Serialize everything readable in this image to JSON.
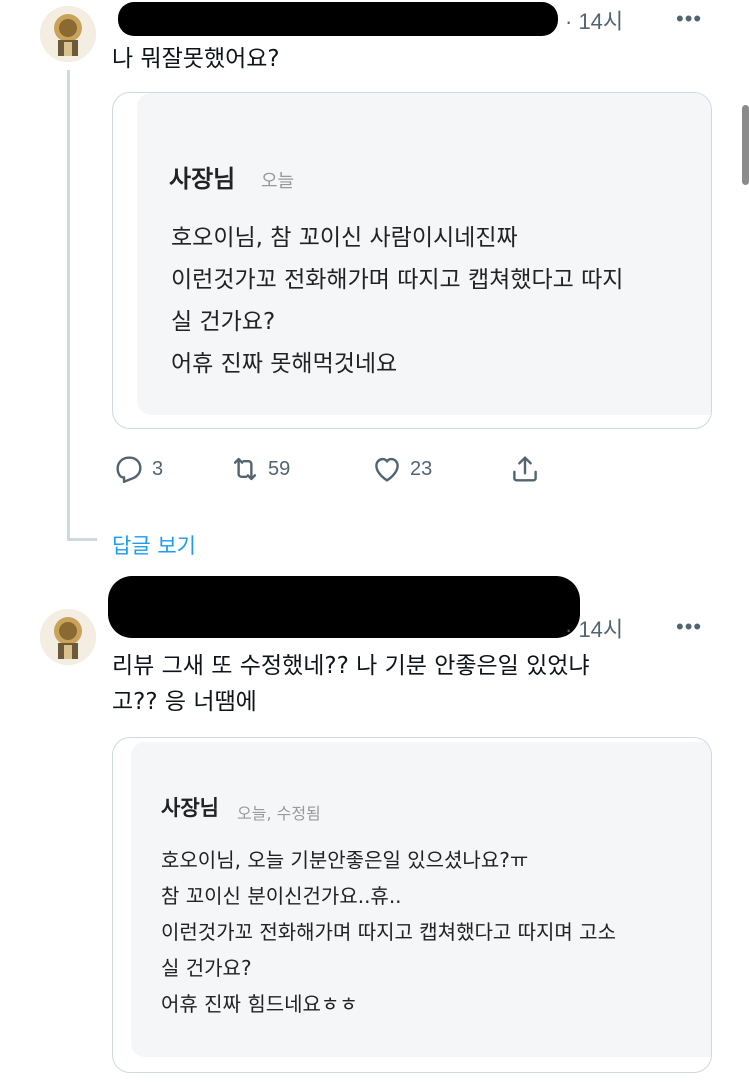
{
  "colors": {
    "accent": "#1d9bf0",
    "muted": "#536471",
    "thread_line": "#cfd9de"
  },
  "tweets": [
    {
      "time": "· 14시",
      "more": "•••",
      "text_lines": [
        "나 뭐잘못했어요?"
      ],
      "quote": {
        "name": "사장님",
        "meta": "오늘",
        "lines": [
          "호오이님, 참 꼬이신 사람이시네진짜",
          "이런것가꼬 전화해가며 따지고 캡쳐했다고 따지",
          "실 건가요?",
          "어휴 진짜 못해먹것네요"
        ]
      },
      "actions": {
        "reply_count": "3",
        "retweet_count": "59",
        "like_count": "23"
      },
      "show_replies": "답글 보기"
    },
    {
      "time": "· 14시",
      "more": "•••",
      "text_lines": [
        "리뷰 그새 또 수정했네?? 나 기분 안좋은일 있었냐",
        "고?? 응 너땜에"
      ],
      "quote": {
        "name": "사장님",
        "meta": "오늘, 수정됨",
        "lines": [
          "호오이님, 오늘 기분안좋은일 있으셨나요?ㅠ",
          "참 꼬이신 분이신건가요..휴..",
          "이런것가꼬 전화해가며 따지고 캡쳐했다고 따지며 고소",
          "실 건가요?",
          "어휴 진짜 힘드네요ㅎㅎ"
        ]
      }
    }
  ]
}
